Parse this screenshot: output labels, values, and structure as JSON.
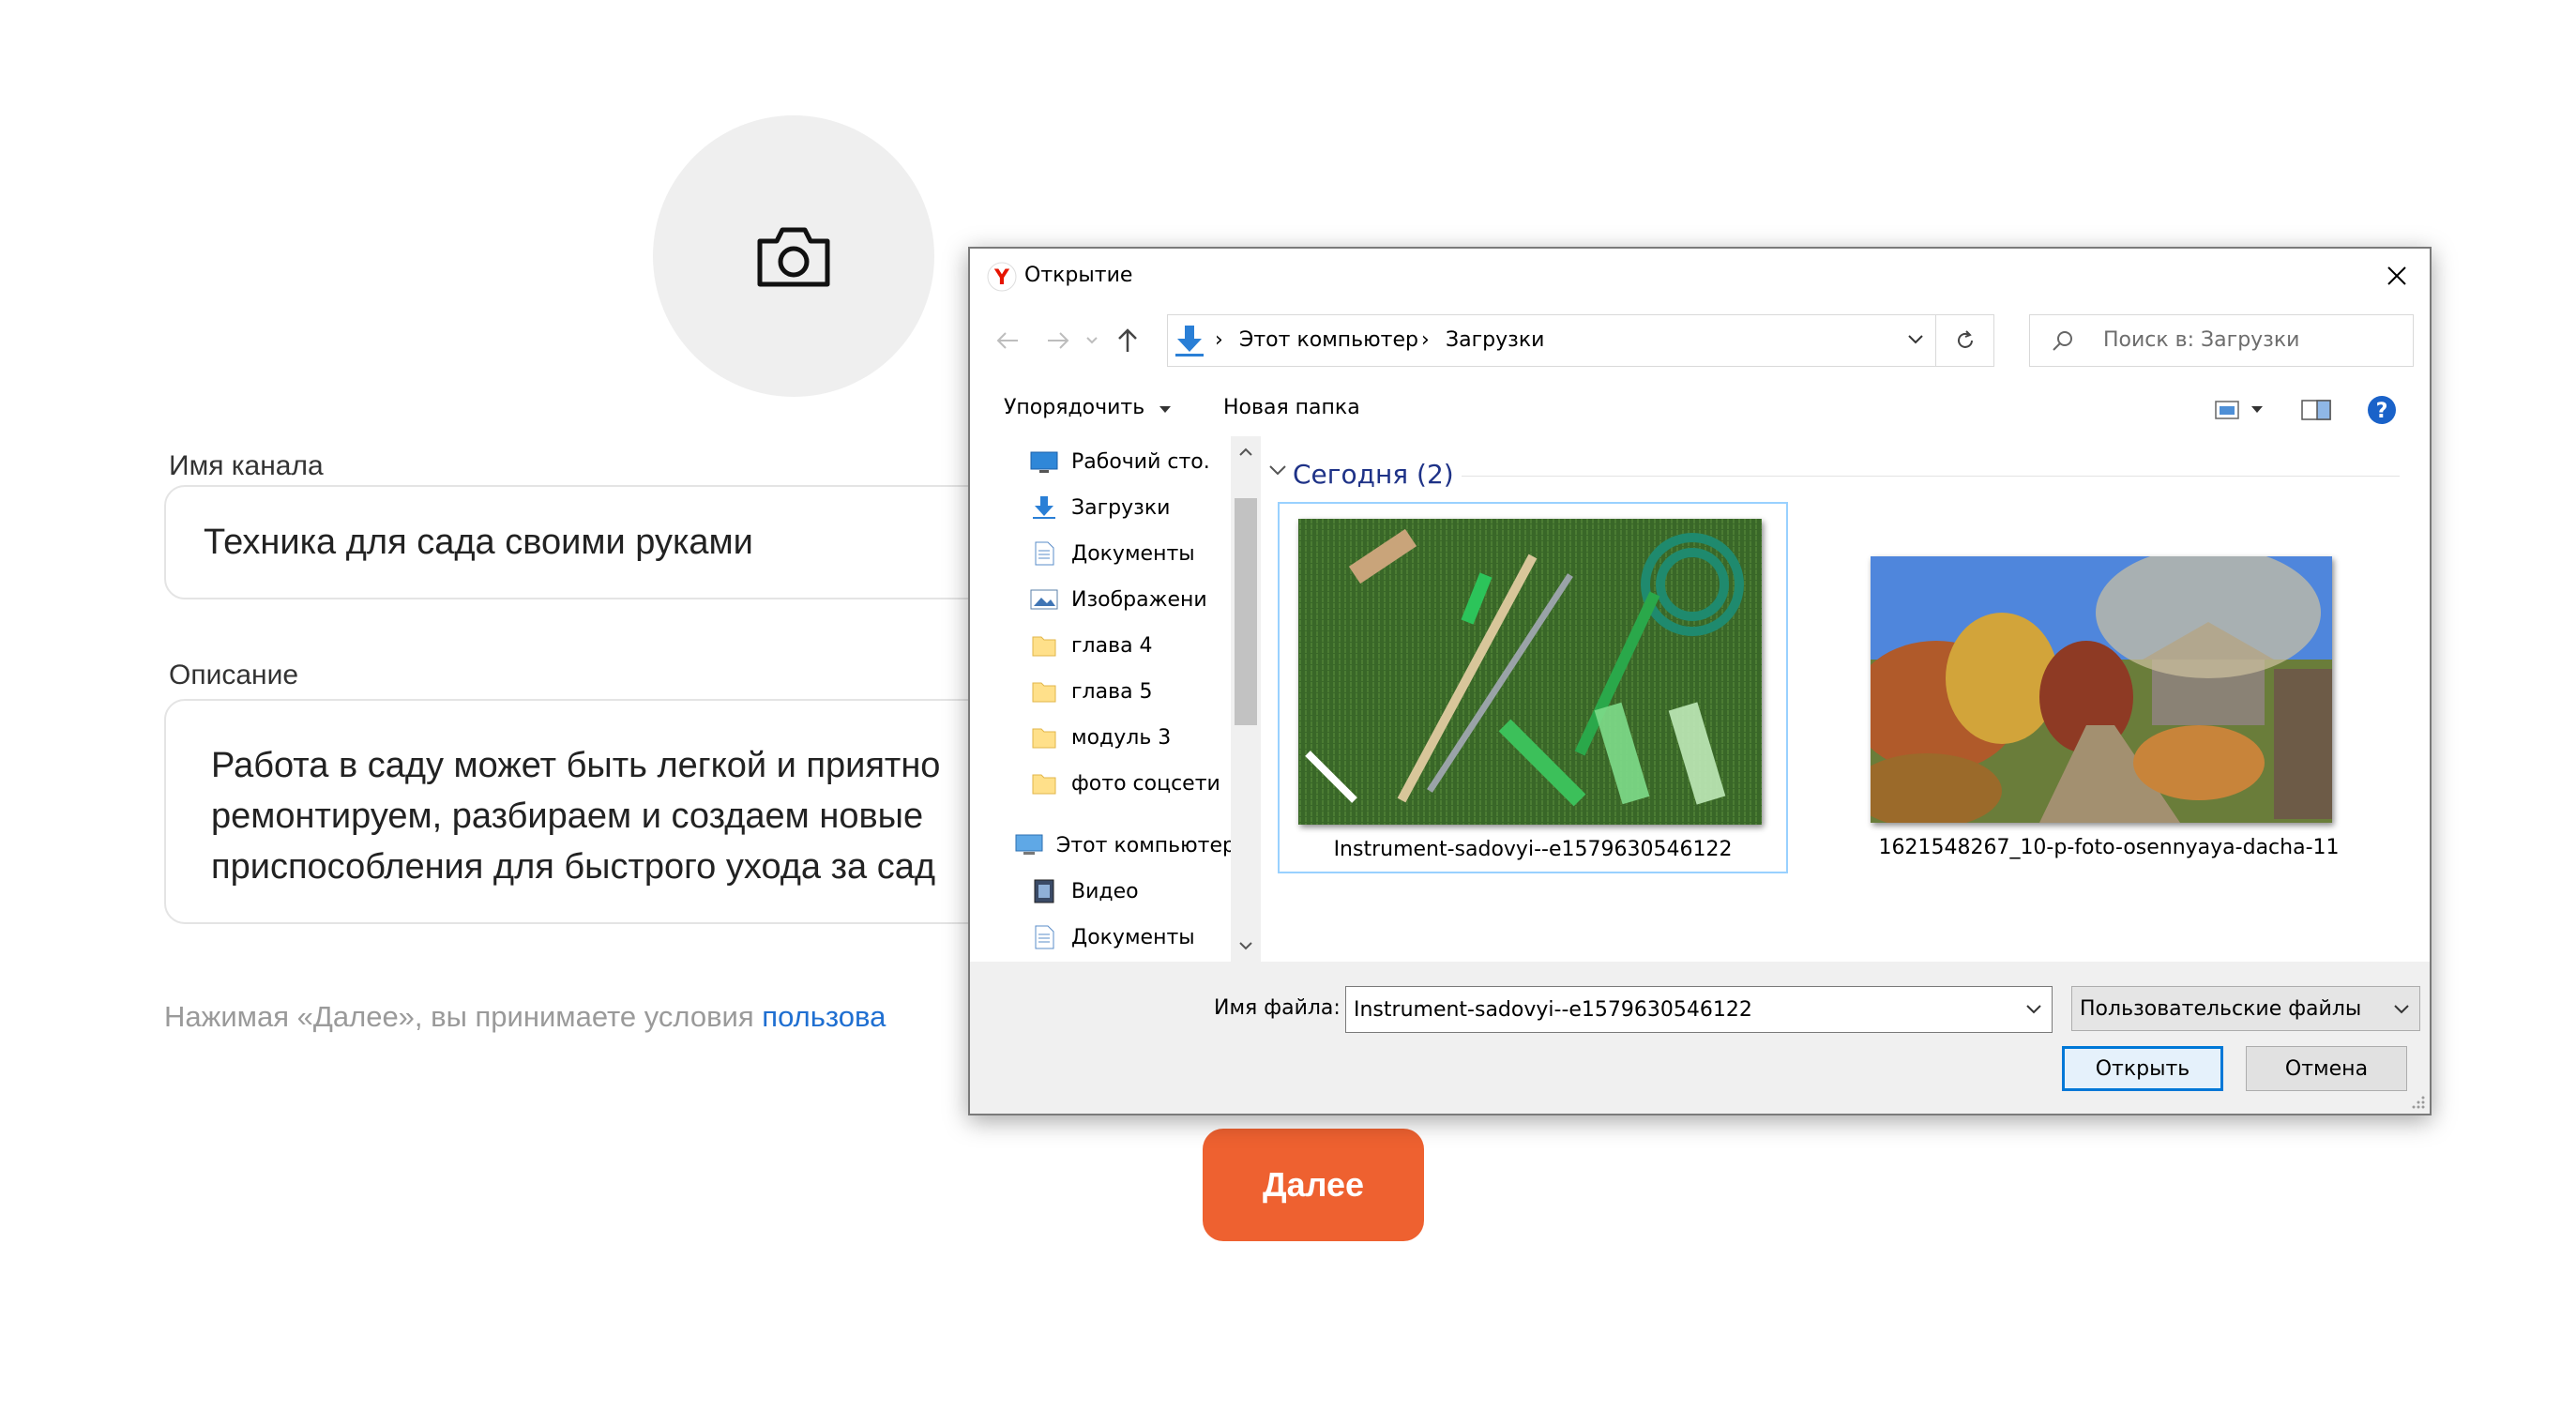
{
  "page": {
    "channel_name_label": "Имя канала",
    "channel_name_value": "Техника для сада своими руками",
    "description_label": "Описание",
    "description_lines": [
      "Работа в саду может быть легкой и приятно",
      "ремонтируем, разбираем и создаем новые",
      "приспособления для быстрого ухода за сад"
    ],
    "terms_text": "Нажимая «Далее», вы принимаете условия ",
    "terms_link": "пользова",
    "next_button": "Далее",
    "accent_color": "#ee6130"
  },
  "dialog": {
    "title": "Открытие",
    "app_icon": "yandex-browser-icon",
    "breadcrumbs": [
      "Этот компьютер",
      "Загрузки"
    ],
    "search_placeholder": "Поиск в: Загрузки",
    "organize_label": "Упорядочить",
    "new_folder_label": "Новая папка",
    "nav_items": [
      {
        "label": "Рабочий сто.",
        "icon": "desktop-icon",
        "pinned": true
      },
      {
        "label": "Загрузки",
        "icon": "download-icon",
        "pinned": true
      },
      {
        "label": "Документы",
        "icon": "document-icon",
        "pinned": true
      },
      {
        "label": "Изображени",
        "icon": "pictures-icon",
        "pinned": true
      },
      {
        "label": "глава 4",
        "icon": "folder-icon",
        "pinned": false
      },
      {
        "label": "глава 5",
        "icon": "folder-icon",
        "pinned": false
      },
      {
        "label": "модуль 3",
        "icon": "folder-icon",
        "pinned": false
      },
      {
        "label": "фото соцсети",
        "icon": "folder-icon",
        "pinned": false
      }
    ],
    "this_pc_label": "Этот компьютер",
    "pc_items": [
      {
        "label": "Видео",
        "icon": "video-icon"
      },
      {
        "label": "Документы",
        "icon": "document-icon"
      }
    ],
    "group_header": "Сегодня (2)",
    "files": [
      {
        "name": "Instrument-sadovyi--e1579630546122",
        "selected": true
      },
      {
        "name": "1621548267_10-p-foto-osennyaya-dacha-11",
        "selected": false
      }
    ],
    "filename_label": "Имя файла:",
    "filename_value": "Instrument-sadovyi--e1579630546122",
    "filetype_value": "Пользовательские файлы",
    "open_button": "Открыть",
    "cancel_button": "Отмена",
    "selection_color": "#99d1ff",
    "primary_button_border": "#0078d7"
  }
}
